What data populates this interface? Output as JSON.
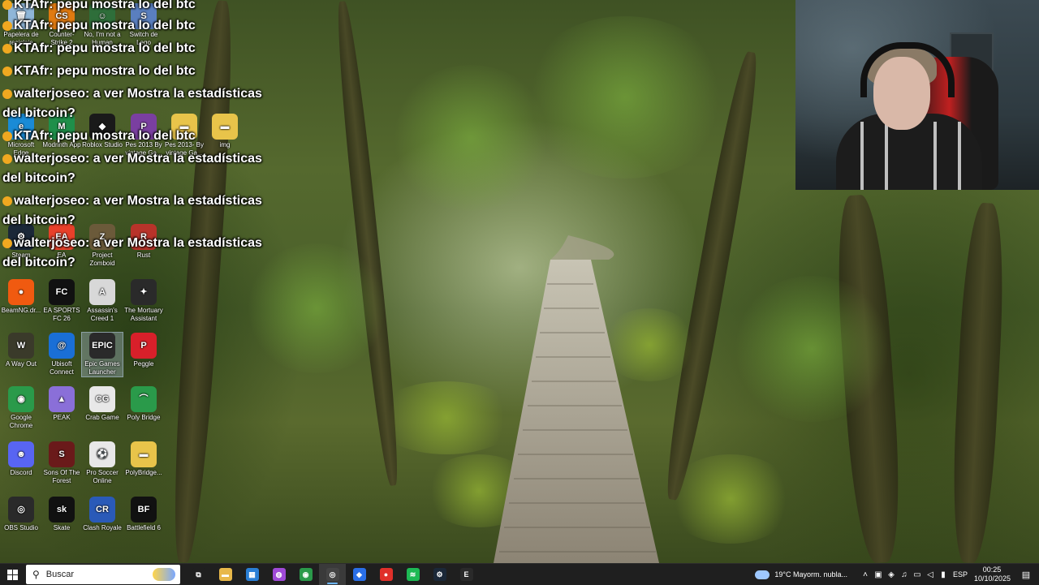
{
  "desktop_icons": [
    {
      "label": "Papelera de reciclaje",
      "icon": "recycle-bin-icon",
      "color": "#8fb6d8",
      "glyph": "🗑"
    },
    {
      "label": "Counter-Strike 2",
      "icon": "cs2-icon",
      "color": "#e07a10",
      "glyph": "CS"
    },
    {
      "label": "No, I'm not a Human",
      "icon": "not-human-icon",
      "color": "#2e6e3a",
      "glyph": "☺"
    },
    {
      "label": "Switch de Lego",
      "icon": "lego-switch-icon",
      "color": "#5a7fbf",
      "glyph": "S"
    },
    {
      "label": "Microsoft Edge",
      "icon": "edge-icon",
      "color": "#1a8bd6",
      "glyph": "e"
    },
    {
      "label": "Modrinth App",
      "icon": "modrinth-icon",
      "color": "#1f8f4a",
      "glyph": "M"
    },
    {
      "label": "Roblox Studio",
      "icon": "roblox-studio-icon",
      "color": "#1a1a1a",
      "glyph": "◆"
    },
    {
      "label": "Pes 2013 By vintage Ga...",
      "icon": "pes-icon",
      "color": "#7a3fa0",
      "glyph": "P"
    },
    {
      "label": "Pes 2013- By vintage Ga...",
      "icon": "folder-icon",
      "color": "#e8c44a",
      "glyph": "▬"
    },
    {
      "label": "img",
      "icon": "folder-icon",
      "color": "#e8c44a",
      "glyph": "▬"
    },
    {
      "label": "Steam",
      "icon": "steam-icon",
      "color": "#1b2838",
      "glyph": "⚙"
    },
    {
      "label": "EA",
      "icon": "ea-icon",
      "color": "#e8402a",
      "glyph": "EA"
    },
    {
      "label": "Project Zomboid",
      "icon": "zomboid-icon",
      "color": "#6b5a3a",
      "glyph": "Z"
    },
    {
      "label": "Rust",
      "icon": "rust-icon",
      "color": "#b8332a",
      "glyph": "R"
    },
    {
      "label": "BeamNG.dr...",
      "icon": "beamng-icon",
      "color": "#f05a10",
      "glyph": "●"
    },
    {
      "label": "EA SPORTS FC 26",
      "icon": "fc26-icon",
      "color": "#111111",
      "glyph": "FC"
    },
    {
      "label": "Assassin's Creed 1",
      "icon": "assassins-creed-icon",
      "color": "#d8d8d8",
      "glyph": "A"
    },
    {
      "label": "The Mortuary Assistant",
      "icon": "mortuary-icon",
      "color": "#2a2a2a",
      "glyph": "✦"
    },
    {
      "label": "A Way Out",
      "icon": "a-way-out-icon",
      "color": "#3a3a2a",
      "glyph": "W"
    },
    {
      "label": "Ubisoft Connect",
      "icon": "ubisoft-icon",
      "color": "#1a6fd6",
      "glyph": "@"
    },
    {
      "label": "Epic Games Launcher",
      "icon": "epic-games-icon",
      "color": "#2a2a2a",
      "glyph": "EPIC"
    },
    {
      "label": "Peggle",
      "icon": "peggle-icon",
      "color": "#d8202a",
      "glyph": "P"
    },
    {
      "label": "Google Chrome",
      "icon": "chrome-icon",
      "color": "#2a9a4a",
      "glyph": "◉"
    },
    {
      "label": "PEAK",
      "icon": "peak-icon",
      "color": "#8a6fd8",
      "glyph": "▲"
    },
    {
      "label": "Crab Game",
      "icon": "crab-game-icon",
      "color": "#e8e8e8",
      "glyph": "CG"
    },
    {
      "label": "Poly Bridge",
      "icon": "poly-bridge-icon",
      "color": "#2a9a4a",
      "glyph": "⌒"
    },
    {
      "label": "Discord",
      "icon": "discord-icon",
      "color": "#5865f2",
      "glyph": "☻"
    },
    {
      "label": "Sons Of The Forest",
      "icon": "sons-forest-icon",
      "color": "#6a1a1a",
      "glyph": "S"
    },
    {
      "label": "Pro Soccer Online",
      "icon": "pro-soccer-icon",
      "color": "#e8e8e8",
      "glyph": "⚽"
    },
    {
      "label": "PolyBridge...",
      "icon": "folder-icon",
      "color": "#e8c44a",
      "glyph": "▬"
    },
    {
      "label": "OBS Studio",
      "icon": "obs-icon",
      "color": "#2a2a2a",
      "glyph": "◎"
    },
    {
      "label": "Skate",
      "icon": "skate-icon",
      "color": "#111111",
      "glyph": "sk"
    },
    {
      "label": "Clash Royale",
      "icon": "clash-royale-icon",
      "color": "#2a5ab8",
      "glyph": "CR"
    },
    {
      "label": "Battlefield 6",
      "icon": "battlefield-icon",
      "color": "#111111",
      "glyph": "BF"
    }
  ],
  "chat": [
    {
      "user": "KTAfr:",
      "text": " pepu mostra lo del btc"
    },
    {
      "user": "KTAfr:",
      "text": " pepu mostra lo del btc"
    },
    {
      "user": "KTAfr:",
      "text": " pepu mostra lo del btc"
    },
    {
      "user": "KTAfr:",
      "text": " pepu mostra lo del btc"
    },
    {
      "user": "walterjoseo:",
      "text": " a ver Mostra la estadísticas del bitcoin?"
    },
    {
      "user": "KTAfr:",
      "text": " pepu mostra lo del btc"
    },
    {
      "user": "walterjoseo:",
      "text": " a ver Mostra la estadísticas del bitcoin?"
    },
    {
      "user": "walterjoseo:",
      "text": " a ver Mostra la estadísticas del bitcoin?"
    },
    {
      "user": "walterjoseo:",
      "text": " a ver Mostra la estadísticas del bitcoin?"
    }
  ],
  "taskbar": {
    "search_placeholder": "Buscar",
    "apps": [
      {
        "name": "task-view-icon",
        "glyph": "⧉",
        "color": "#1f1f1f"
      },
      {
        "name": "file-explorer-icon",
        "glyph": "▬",
        "color": "#e8b84a"
      },
      {
        "name": "microsoft-store-icon",
        "glyph": "▦",
        "color": "#2a7fd6"
      },
      {
        "name": "chat-app-icon",
        "glyph": "◍",
        "color": "#a04ad8"
      },
      {
        "name": "chrome-icon",
        "glyph": "◉",
        "color": "#2a9a4a"
      },
      {
        "name": "obs-icon",
        "glyph": "◎",
        "color": "#444444",
        "active": true
      },
      {
        "name": "app-blue-icon",
        "glyph": "◆",
        "color": "#2a6fe8"
      },
      {
        "name": "record-app-icon",
        "glyph": "●",
        "color": "#e0302a"
      },
      {
        "name": "spotify-icon",
        "glyph": "≋",
        "color": "#1db954"
      },
      {
        "name": "steam-icon",
        "glyph": "⚙",
        "color": "#1b2838"
      },
      {
        "name": "epic-games-icon",
        "glyph": "E",
        "color": "#2a2a2a"
      }
    ],
    "weather": "19°C  Mayorm. nubla...",
    "language": "ESP",
    "time": "00:25",
    "date": "10/10/2025"
  }
}
